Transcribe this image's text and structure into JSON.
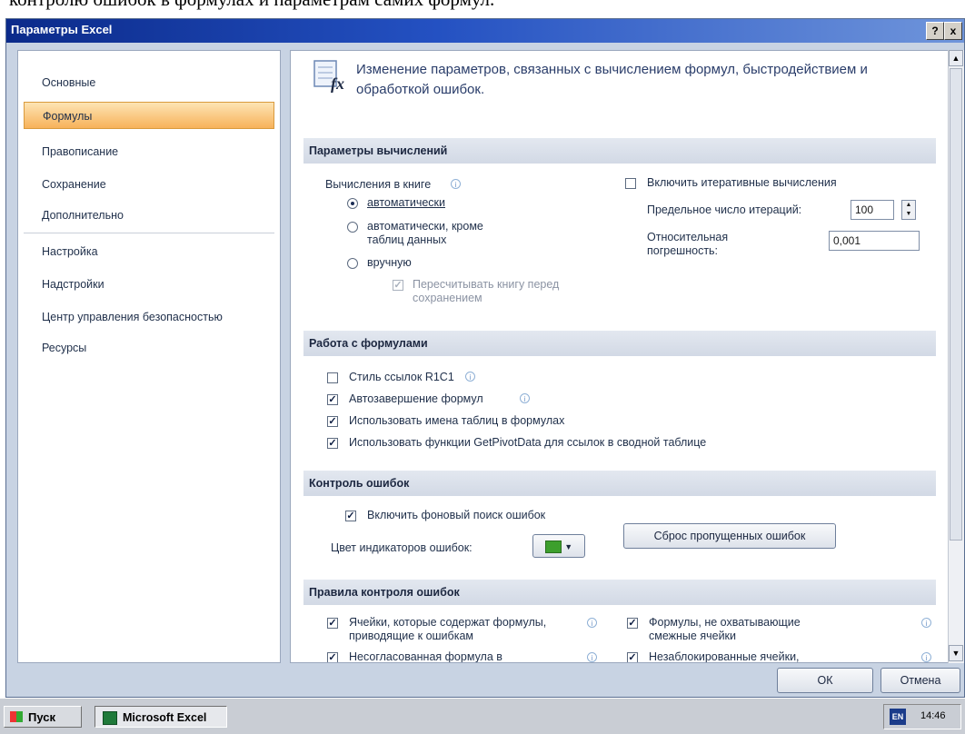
{
  "background_text": "контролю ошибок в формулах и параметрам самих формул.",
  "window": {
    "title": "Параметры Excel",
    "help_button": "?",
    "close_button": "x"
  },
  "sidebar": {
    "items": [
      {
        "label": "Основные"
      },
      {
        "label": "Формулы"
      },
      {
        "label": "Правописание"
      },
      {
        "label": "Сохранение"
      },
      {
        "label": "Дополнительно"
      },
      {
        "label": "Настройка"
      },
      {
        "label": "Надстройки"
      },
      {
        "label": "Центр управления безопасностью"
      },
      {
        "label": "Ресурсы"
      }
    ],
    "active_index": 1
  },
  "header": {
    "text": "Изменение параметров, связанных с вычислением формул, быстродействием и обработкой ошибок.",
    "icon": "fx-icon"
  },
  "calc_section": {
    "title": "Параметры вычислений",
    "workbook_label": "Вычисления в книге",
    "radios": [
      {
        "label": "автоматически",
        "checked": true
      },
      {
        "label": "автоматически, кроме таблиц данных",
        "checked": false
      },
      {
        "label": "вручную",
        "checked": false
      }
    ],
    "recalc_before_save": {
      "label": "Пересчитывать книгу перед сохранением",
      "checked": true,
      "disabled": true
    },
    "iterative": {
      "label": "Включить итеративные вычисления",
      "checked": false
    },
    "max_iterations": {
      "label": "Предельное число итераций:",
      "value": "100"
    },
    "max_change": {
      "label": "Относительная погрешность:",
      "value": "0,001"
    }
  },
  "formulas_section": {
    "title": "Работа с формулами",
    "options": [
      {
        "label": "Стиль ссылок R1C1",
        "checked": false,
        "info": true
      },
      {
        "label": "Автозавершение формул",
        "checked": true,
        "info": true
      },
      {
        "label": "Использовать имена таблиц в формулах",
        "checked": true,
        "info": false
      },
      {
        "label": "Использовать функции GetPivotData для ссылок в сводной таблице",
        "checked": true,
        "info": false
      }
    ]
  },
  "errors_section": {
    "title": "Контроль ошибок",
    "background_checking": {
      "label": "Включить фоновый поиск ошибок",
      "checked": true
    },
    "indicator_color_label": "Цвет индикаторов ошибок:",
    "reset_button": "Сброс пропущенных ошибок"
  },
  "rules_section": {
    "title": "Правила контроля ошибок",
    "rules": [
      {
        "label": "Ячейки, которые содержат формулы, приводящие к ошибкам",
        "checked": true
      },
      {
        "label": "Формулы, не охватывающие смежные ячейки",
        "checked": true
      },
      {
        "label": "Несогласованная формула в",
        "checked": true
      },
      {
        "label": "Незаблокированные ячейки,",
        "checked": true
      }
    ]
  },
  "footer": {
    "ok": "ОК",
    "cancel": "Отмена"
  },
  "taskbar": {
    "start": "Пуск",
    "app": "Microsoft Excel",
    "lang": "EN",
    "time": "14:46"
  }
}
